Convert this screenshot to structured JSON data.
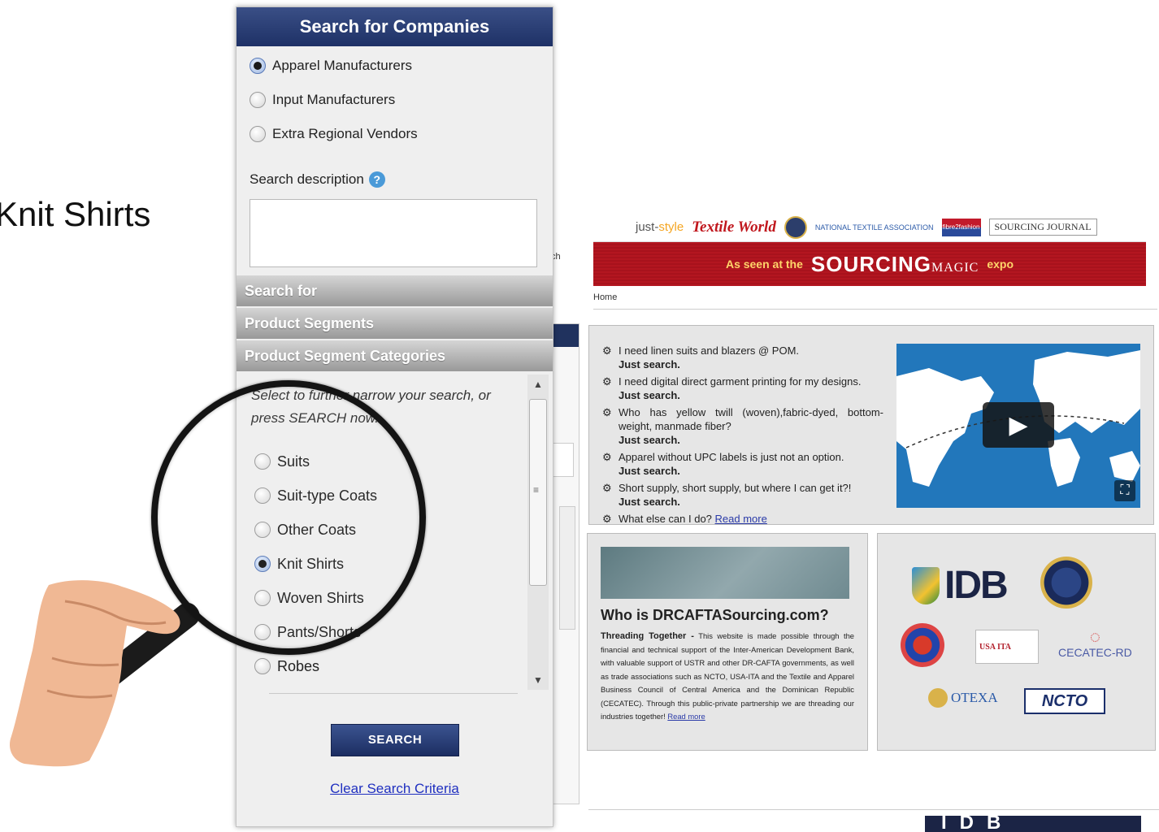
{
  "slide": {
    "label": "Knit Shirts"
  },
  "site": {
    "logos": {
      "just_style_a": "just-",
      "just_style_b": "style",
      "textile_world": "Textile World",
      "nta": "NATIONAL TEXTILE ASSOCIATION",
      "fibre_fashion": "fibre2fashion",
      "sourcing_journal": "SOURCING JOURNAL"
    },
    "banner": {
      "seen": "As seen at the",
      "brand": "SOURCING",
      "magic": "MAGIC",
      "expo": "expo"
    },
    "home_link": "Home",
    "left_fragment": {
      "a": "ch"
    },
    "questions": [
      {
        "text": "I need linen suits and blazers @ POM.",
        "emph": "Just search."
      },
      {
        "text": "I need digital direct garment printing for my designs.",
        "emph": "Just search."
      },
      {
        "text": "Who has yellow twill (woven),fabric-dyed, bottom-weight, manmade fiber?",
        "emph": "Just search."
      },
      {
        "text": "Apparel without UPC labels is just not an option.",
        "emph": "Just search."
      },
      {
        "text": "Short supply, short supply, but where I can get it?!",
        "emph": "Just search."
      }
    ],
    "last_question": {
      "text": "What else can I do?",
      "link": "Read more"
    },
    "video": {
      "play_glyph": "▶",
      "expand_glyph": "⛶"
    },
    "who": {
      "title": "Who is DRCAFTASourcing.com?",
      "lead": "Threading Together -",
      "body": "This website is made possible through the financial and technical support of the Inter-American Development Bank, with valuable support of USTR and other DR-CAFTA governments, as well as trade associations such as NCTO, USA-ITA and the Textile and Apparel Business Council of Central America and the Dominican Republic (CECATEC). Through this public-private partnership we are threading our industries together!",
      "link": "Read more"
    },
    "partners": {
      "idb": "IDB",
      "usa_ita": "USA ITA",
      "cecatec": "CECATEC-RD",
      "otexa": "OTEXA",
      "ncto": "NCTO"
    },
    "bottom_idb": "IDB"
  },
  "panel": {
    "title": "Search for Companies",
    "company_types": [
      {
        "label": "Apparel Manufacturers",
        "checked": true
      },
      {
        "label": "Input Manufacturers",
        "checked": false
      },
      {
        "label": "Extra Regional Vendors",
        "checked": false
      }
    ],
    "desc_label": "Search description",
    "help_glyph": "?",
    "desc_value": "",
    "sections": [
      "Search for",
      "Product Segments",
      "Product Segment Categories"
    ],
    "hint": "Select to further narrow your search, or press SEARCH now.",
    "categories": [
      {
        "label": "Suits",
        "checked": false
      },
      {
        "label": "Suit-type Coats",
        "checked": false
      },
      {
        "label": "Other Coats",
        "checked": false
      },
      {
        "label": "Knit Shirts",
        "checked": true
      },
      {
        "label": "Woven Shirts",
        "checked": false
      },
      {
        "label": "Pants/Shorts",
        "checked": false
      },
      {
        "label": "Robes",
        "checked": false
      }
    ],
    "scroll_up": "▲",
    "scroll_down": "▼",
    "scroll_grip": "≡",
    "search_button": "SEARCH",
    "clear_link": "Clear Search Criteria"
  },
  "colors": {
    "header_navy": "#1e3166",
    "banner_red": "#b31620",
    "link_blue": "#2030c0"
  }
}
